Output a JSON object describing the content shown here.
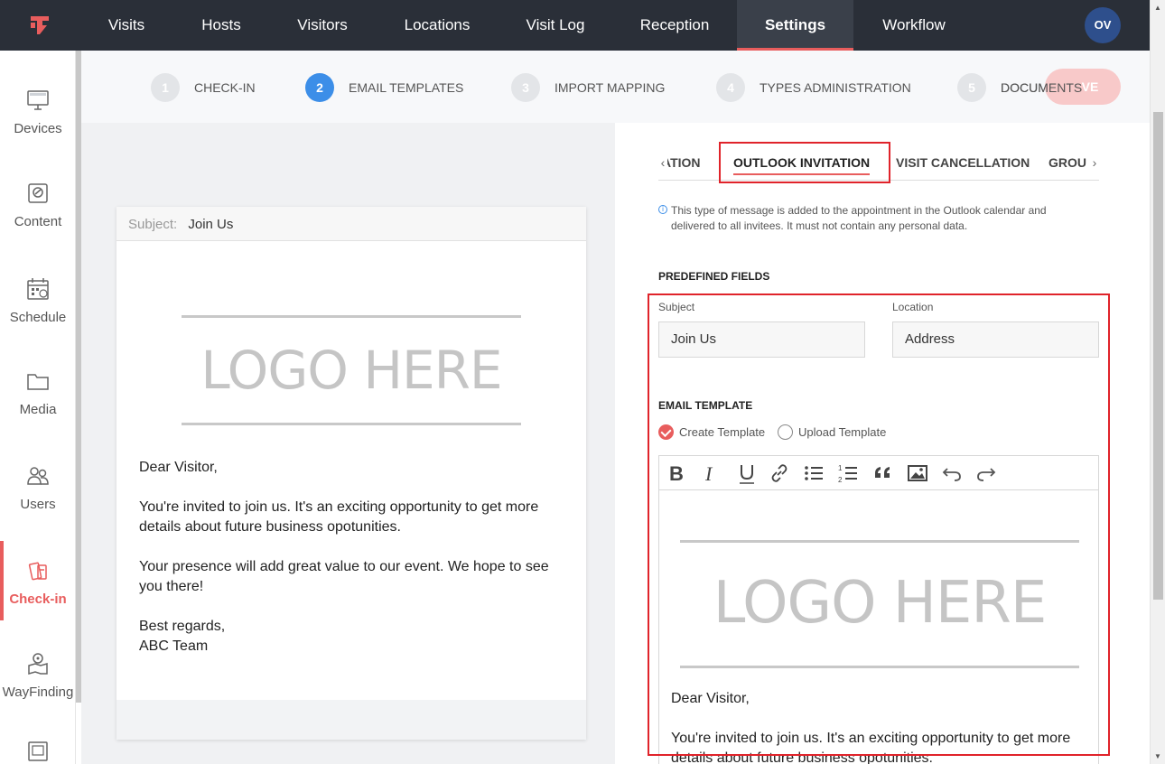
{
  "nav": {
    "items": [
      {
        "label": "Visits"
      },
      {
        "label": "Hosts"
      },
      {
        "label": "Visitors"
      },
      {
        "label": "Locations"
      },
      {
        "label": "Visit Log"
      },
      {
        "label": "Reception"
      },
      {
        "label": "Settings",
        "active": true
      },
      {
        "label": "Workflow"
      }
    ],
    "avatar": "OV",
    "accent": "#e85d5d"
  },
  "sidebar": {
    "items": [
      {
        "label": "Devices",
        "icon": "monitor-icon"
      },
      {
        "label": "Content",
        "icon": "content-icon"
      },
      {
        "label": "Schedule",
        "icon": "calendar-icon"
      },
      {
        "label": "Media",
        "icon": "folder-icon"
      },
      {
        "label": "Users",
        "icon": "users-icon"
      },
      {
        "label": "Check-in",
        "icon": "checkin-icon",
        "active": true
      },
      {
        "label": "WayFinding",
        "icon": "wayfinding-icon"
      }
    ]
  },
  "steps": [
    {
      "num": "1",
      "label": "CHECK-IN"
    },
    {
      "num": "2",
      "label": "EMAIL TEMPLATES",
      "active": true
    },
    {
      "num": "3",
      "label": "IMPORT MAPPING"
    },
    {
      "num": "4",
      "label": "TYPES ADMINISTRATION"
    },
    {
      "num": "5",
      "label": "DOCUMENTS"
    }
  ],
  "save_label": "VE",
  "preview": {
    "subject_label": "Subject:",
    "subject_value": "Join Us",
    "logo_text": "LOGO HERE",
    "greeting": "Dear Visitor,",
    "para1": "You're invited to join us. It's an exciting opportunity to get more details about future business opotunities.",
    "para2": "Your presence will add great value to our event. We hope to see you there!",
    "signoff": "Best regards,",
    "team": "ABC Team"
  },
  "tabs": {
    "items": [
      {
        "label": "ATION"
      },
      {
        "label": "OUTLOOK INVITATION",
        "active": true
      },
      {
        "label": "VISIT CANCELLATION"
      },
      {
        "label": "GROU"
      }
    ],
    "prev_arrow": "‹",
    "next_arrow": "›"
  },
  "info_text": "This type of message is added to the appointment in the Outlook calendar and delivered to all invitees. It must not contain any personal data.",
  "predefined": {
    "title": "PREDEFINED FIELDS",
    "subject_label": "Subject",
    "subject_value": "Join Us",
    "location_label": "Location",
    "location_value": "Address"
  },
  "template": {
    "title": "EMAIL TEMPLATE",
    "option_create": "Create Template",
    "option_upload": "Upload Template",
    "selected": "create"
  },
  "editor": {
    "toolbar": [
      "bold-icon",
      "italic-icon",
      "underline-icon",
      "link-icon",
      "bullet-list-icon",
      "numbered-list-icon",
      "quote-icon",
      "image-icon",
      "undo-icon",
      "redo-icon"
    ],
    "logo_text": "LOGO HERE",
    "greeting": "Dear Visitor,",
    "para1": "You're invited to join us. It's an exciting opportunity to get more details about future business opotunities."
  }
}
